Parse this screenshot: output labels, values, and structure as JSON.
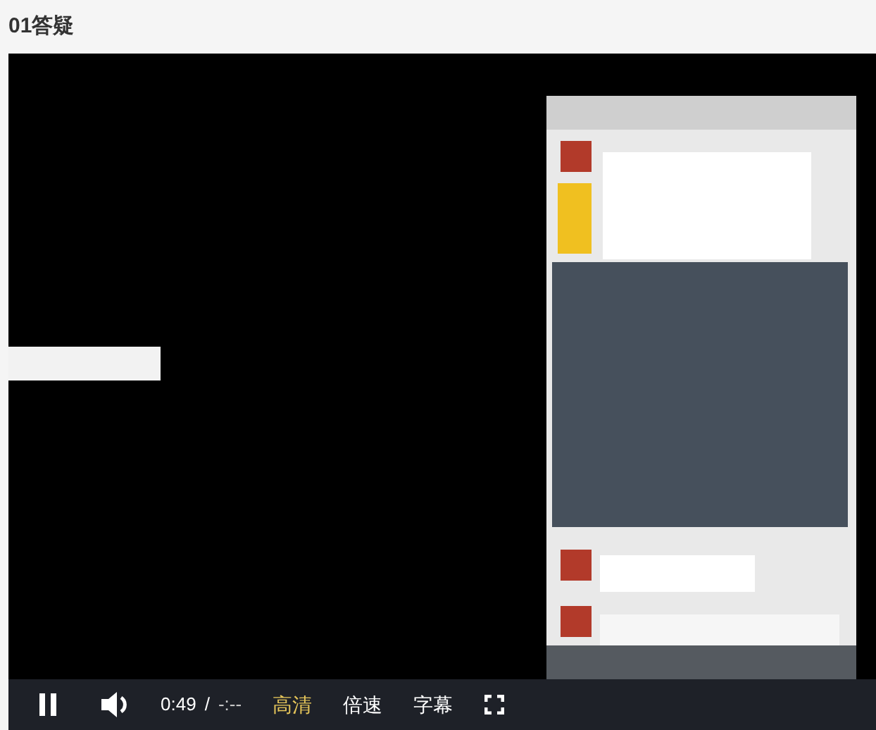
{
  "page": {
    "title": "01答疑"
  },
  "player": {
    "playing": true,
    "current_time": "0:49",
    "separator": "/",
    "duration": "-:--",
    "options": [
      {
        "label": "高清",
        "selected": true
      },
      {
        "label": "倍速",
        "selected": false
      },
      {
        "label": "字幕",
        "selected": false
      }
    ]
  }
}
